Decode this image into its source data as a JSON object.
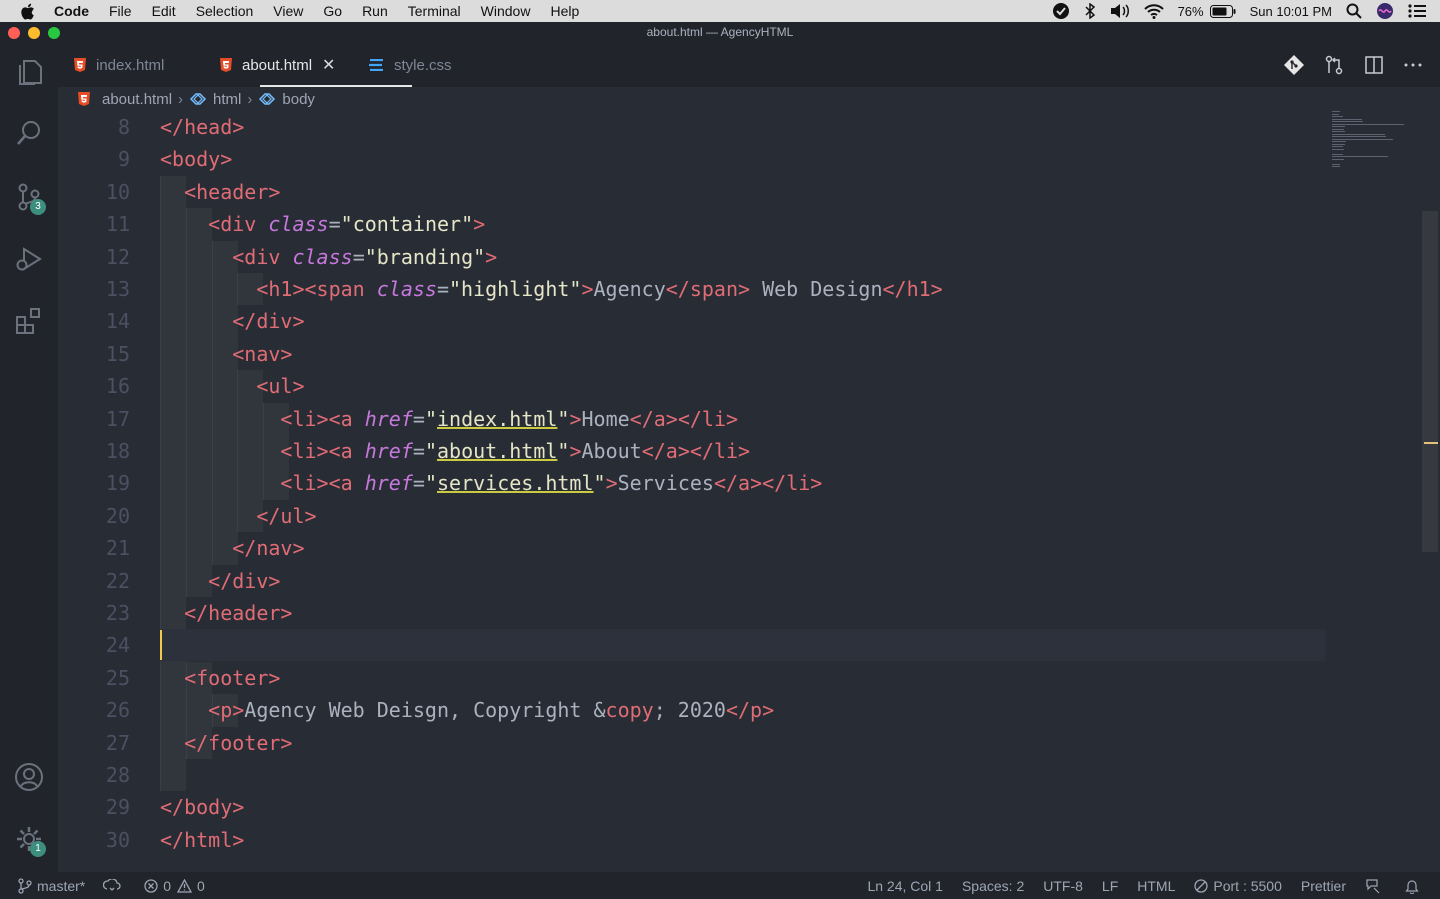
{
  "menubar": {
    "app": "Code",
    "items": [
      "File",
      "Edit",
      "Selection",
      "View",
      "Go",
      "Run",
      "Terminal",
      "Window",
      "Help"
    ],
    "battery": "76%",
    "clock": "Sun 10:01 PM"
  },
  "window": {
    "title": "about.html — AgencyHTML"
  },
  "activity": {
    "scm_badge": "3",
    "settings_badge": "1"
  },
  "tabs": [
    {
      "label": "index.html",
      "icon": "html5-icon"
    },
    {
      "label": "about.html",
      "icon": "html5-icon",
      "active": true
    },
    {
      "label": "style.css",
      "icon": "css3-icon"
    }
  ],
  "breadcrumb": [
    "about.html",
    "html",
    "body"
  ],
  "editor": {
    "line_numbers": [
      "8",
      "9",
      "10",
      "11",
      "12",
      "13",
      "14",
      "15",
      "16",
      "17",
      "18",
      "19",
      "20",
      "21",
      "22",
      "23",
      "24",
      "25",
      "26",
      "27",
      "28",
      "29",
      "30"
    ],
    "current_line": "24",
    "lines": [
      {
        "n": "8",
        "tokens": [
          [
            "t",
            "</head>"
          ]
        ]
      },
      {
        "n": "9",
        "tokens": [
          [
            "t",
            "<body>"
          ]
        ]
      },
      {
        "n": "10",
        "tokens": [
          [
            "p",
            "  "
          ],
          [
            "t",
            "<header>"
          ]
        ]
      },
      {
        "n": "11",
        "tokens": [
          [
            "p",
            "    "
          ],
          [
            "t",
            "<div "
          ],
          [
            "a",
            "class"
          ],
          [
            "p",
            "="
          ],
          [
            "s",
            "\"container\""
          ],
          [
            "t",
            ">"
          ]
        ]
      },
      {
        "n": "12",
        "tokens": [
          [
            "p",
            "      "
          ],
          [
            "t",
            "<div "
          ],
          [
            "a",
            "class"
          ],
          [
            "p",
            "="
          ],
          [
            "s",
            "\"branding\""
          ],
          [
            "t",
            ">"
          ]
        ]
      },
      {
        "n": "13",
        "tokens": [
          [
            "p",
            "        "
          ],
          [
            "t",
            "<h1><span "
          ],
          [
            "a",
            "class"
          ],
          [
            "p",
            "="
          ],
          [
            "s",
            "\"highlight\""
          ],
          [
            "t",
            ">"
          ],
          [
            "p",
            "Agency"
          ],
          [
            "t",
            "</span>"
          ],
          [
            "p",
            " Web Design"
          ],
          [
            "t",
            "</h1>"
          ]
        ]
      },
      {
        "n": "14",
        "tokens": [
          [
            "p",
            "      "
          ],
          [
            "t",
            "</div>"
          ]
        ]
      },
      {
        "n": "15",
        "tokens": [
          [
            "p",
            "      "
          ],
          [
            "t",
            "<nav>"
          ]
        ]
      },
      {
        "n": "16",
        "tokens": [
          [
            "p",
            "        "
          ],
          [
            "t",
            "<ul>"
          ]
        ]
      },
      {
        "n": "17",
        "tokens": [
          [
            "p",
            "          "
          ],
          [
            "t",
            "<li><a "
          ],
          [
            "a",
            "href"
          ],
          [
            "p",
            "="
          ],
          [
            "s",
            "\""
          ],
          [
            "su",
            "index.html"
          ],
          [
            "s",
            "\""
          ],
          [
            "t",
            ">"
          ],
          [
            "p",
            "Home"
          ],
          [
            "t",
            "</a></li>"
          ]
        ]
      },
      {
        "n": "18",
        "tokens": [
          [
            "p",
            "          "
          ],
          [
            "t",
            "<li><a "
          ],
          [
            "a",
            "href"
          ],
          [
            "p",
            "="
          ],
          [
            "s",
            "\""
          ],
          [
            "su",
            "about.html"
          ],
          [
            "s",
            "\""
          ],
          [
            "t",
            ">"
          ],
          [
            "p",
            "About"
          ],
          [
            "t",
            "</a></li>"
          ]
        ]
      },
      {
        "n": "19",
        "tokens": [
          [
            "p",
            "          "
          ],
          [
            "t",
            "<li><a "
          ],
          [
            "a",
            "href"
          ],
          [
            "p",
            "="
          ],
          [
            "s",
            "\""
          ],
          [
            "su",
            "services.html"
          ],
          [
            "s",
            "\""
          ],
          [
            "t",
            ">"
          ],
          [
            "p",
            "Services"
          ],
          [
            "t",
            "</a></li>"
          ]
        ]
      },
      {
        "n": "20",
        "tokens": [
          [
            "p",
            "        "
          ],
          [
            "t",
            "</ul>"
          ]
        ]
      },
      {
        "n": "21",
        "tokens": [
          [
            "p",
            "      "
          ],
          [
            "t",
            "</nav>"
          ]
        ]
      },
      {
        "n": "22",
        "tokens": [
          [
            "p",
            "    "
          ],
          [
            "t",
            "</div>"
          ]
        ]
      },
      {
        "n": "23",
        "tokens": [
          [
            "p",
            "  "
          ],
          [
            "t",
            "</header>"
          ]
        ]
      },
      {
        "n": "24",
        "tokens": []
      },
      {
        "n": "25",
        "tokens": [
          [
            "p",
            "  "
          ],
          [
            "t",
            "<footer>"
          ]
        ]
      },
      {
        "n": "26",
        "tokens": [
          [
            "p",
            "    "
          ],
          [
            "t",
            "<p>"
          ],
          [
            "p",
            "Agency Web Deisgn, Copyright "
          ],
          [
            "p",
            "&"
          ],
          [
            "ent",
            "copy"
          ],
          [
            "p",
            "; 2020"
          ],
          [
            "t",
            "</p>"
          ]
        ]
      },
      {
        "n": "27",
        "tokens": [
          [
            "p",
            "  "
          ],
          [
            "t",
            "</footer>"
          ]
        ]
      },
      {
        "n": "28",
        "tokens": []
      },
      {
        "n": "29",
        "tokens": [
          [
            "t",
            "</body>"
          ]
        ]
      },
      {
        "n": "30",
        "tokens": [
          [
            "t",
            "</html>"
          ]
        ]
      }
    ]
  },
  "status": {
    "branch": "master*",
    "errors": "0",
    "warnings": "0",
    "position": "Ln 24, Col 1",
    "spaces": "Spaces: 2",
    "encoding": "UTF-8",
    "eol": "LF",
    "language": "HTML",
    "port": "Port : 5500",
    "formatter": "Prettier"
  }
}
